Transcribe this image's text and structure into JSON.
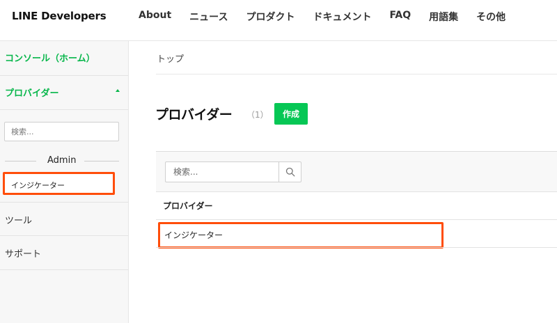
{
  "header": {
    "brand": "LINE Developers",
    "nav": [
      "About",
      "ニュース",
      "プロダクト",
      "ドキュメント",
      "FAQ",
      "用語集",
      "その他"
    ]
  },
  "sidebar": {
    "console": "コンソール（ホーム）",
    "provider": "プロバイダー",
    "search_placeholder": "検索...",
    "group_label": "Admin",
    "selected_item": "インジケーター",
    "tools": "ツール",
    "support": "サポート"
  },
  "main": {
    "breadcrumb": "トップ",
    "title": "プロバイダー",
    "count": "（1）",
    "create_label": "作成",
    "search_placeholder": "検索...",
    "column_header": "プロバイダー",
    "rows": [
      "インジケーター"
    ]
  },
  "colors": {
    "accent": "#06c755",
    "highlight": "#ff4d0a"
  },
  "icons": {
    "search": "search-icon",
    "caret": "caret-up-icon"
  }
}
